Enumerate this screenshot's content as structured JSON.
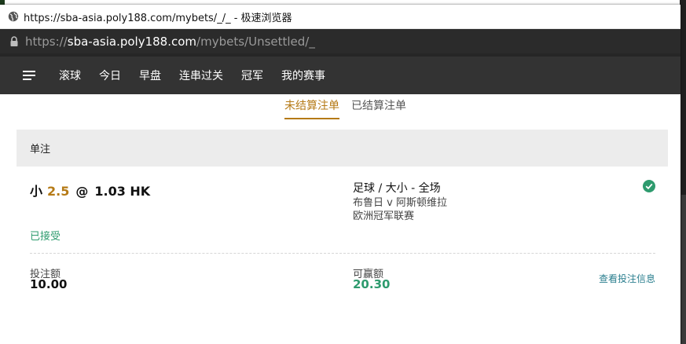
{
  "window_title": "https://sba-asia.poly188.com/mybets/_/_ - 极速浏览器",
  "address": {
    "scheme": "https://",
    "host": "sba-asia.poly188.com",
    "path": "/mybets/Unsettled/_"
  },
  "nav": {
    "menu_icon": "hamburger-menu-icon",
    "items": [
      "滚球",
      "今日",
      "早盘",
      "连串过关",
      "冠军",
      "我的赛事"
    ]
  },
  "tabs": [
    {
      "label": "未结算注单",
      "active": true
    },
    {
      "label": "已结算注单",
      "active": false
    }
  ],
  "section_title": "单注",
  "bet": {
    "selection": "小",
    "line": "2.5",
    "at": "@",
    "odds": "1.03 HK",
    "market": "足球 / 大小 - 全场",
    "match": "布鲁日 v 阿斯顿维拉",
    "league": "欧洲冠军联赛",
    "status": "已接受",
    "status_icon": "check-circle-icon",
    "stake_label": "投注额",
    "stake": "10.00",
    "win_label": "可赢额",
    "win": "20.30",
    "details_link": "查看投注信息"
  },
  "colors": {
    "accent": "#b57a16",
    "success": "#2e9b6e",
    "link": "#2b7f8f",
    "nav_bg": "#333333"
  }
}
